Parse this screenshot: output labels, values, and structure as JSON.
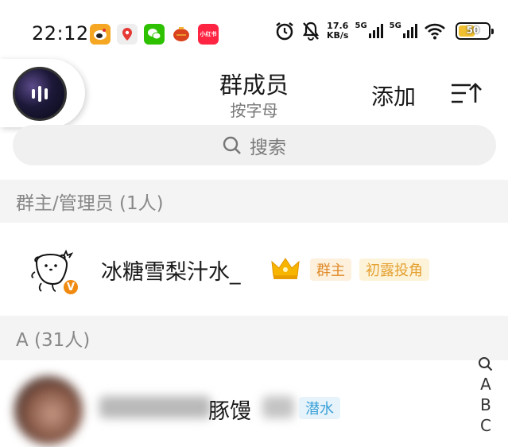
{
  "status_bar": {
    "time": "22:12",
    "notif_apps": [
      {
        "icon": "weibo-icon",
        "color": "#f5a623",
        "label": ""
      },
      {
        "icon": "map-pin-icon",
        "color": "#e8e8e8",
        "label": ""
      },
      {
        "icon": "wechat-icon",
        "color": "#2dc100",
        "label": ""
      },
      {
        "icon": "lantern-icon",
        "color": "#d9421c",
        "label": ""
      },
      {
        "icon": "xiaohongshu-icon",
        "color": "#ff2442",
        "label": "小红书"
      }
    ],
    "net_speed_value": "17.6",
    "net_speed_unit": "KB/s",
    "signal1_label": "5G",
    "signal2_label": "5G",
    "battery_level": "50",
    "battery_fraction": 0.5
  },
  "header": {
    "title": "群成员",
    "subtitle": "按字母",
    "add_label": "添加"
  },
  "search": {
    "placeholder": "搜索"
  },
  "sections": {
    "admins_header": "群主/管理员 (1人)",
    "a_header": "A (31人)"
  },
  "members": {
    "owner": {
      "name": "冰糖雪梨汁水_",
      "role_tag": "群主",
      "title_tag": "初露投角",
      "role_tag_color": "#e08a2a",
      "title_tag_color": "#e4a030"
    },
    "first_a": {
      "name_visible": "豚馒",
      "tag": "潜水",
      "tag_color": "#3aa0d8"
    }
  },
  "index_letters": [
    "A",
    "B",
    "C"
  ],
  "colors": {
    "section_bg": "#f4f4f4",
    "search_bg": "#f0f0f0"
  }
}
